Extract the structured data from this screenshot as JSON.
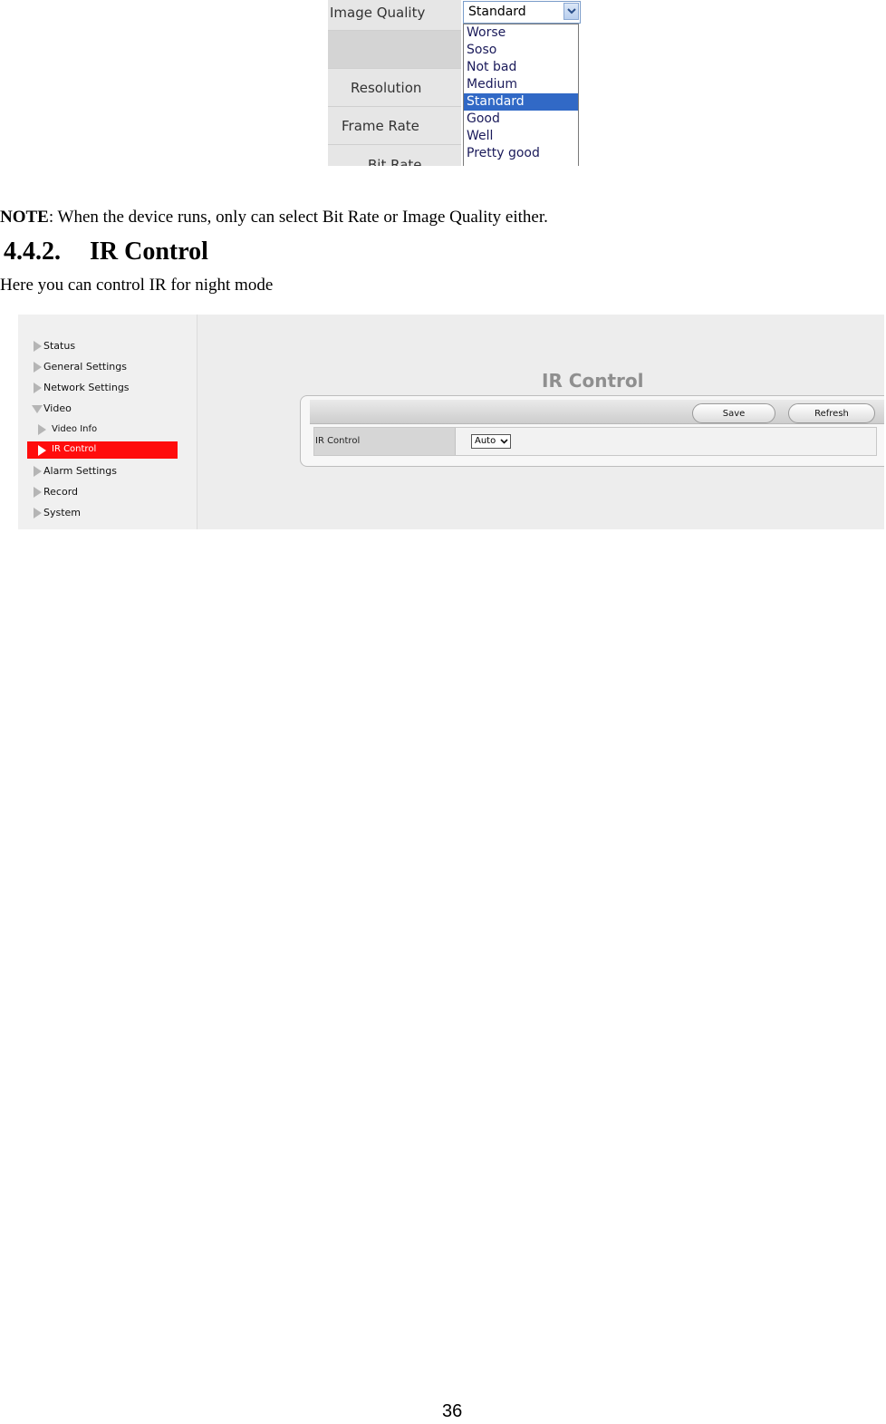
{
  "quality_screenshot": {
    "rows": [
      "Image Quality",
      "",
      "Resolution",
      "Frame Rate",
      "Bit Rate"
    ],
    "selected_value": "Standard",
    "options": [
      "Worse",
      "Soso",
      "Not bad",
      "Medium",
      "Standard",
      "Good",
      "Well",
      "Pretty good"
    ],
    "highlighted_option": "Standard"
  },
  "note": {
    "label": "NOTE",
    "text": ": When the device runs, only can select Bit Rate or Image Quality either."
  },
  "section": {
    "number": "4.4.2.",
    "title": "IR Control",
    "intro": "Here you can control IR for night mode"
  },
  "ir_screenshot": {
    "sidebar": {
      "items": [
        {
          "label": "Status"
        },
        {
          "label": "General Settings"
        },
        {
          "label": "Network Settings"
        },
        {
          "label": "Video"
        },
        {
          "label": "Video Info"
        },
        {
          "label": "IR Control"
        },
        {
          "label": "Alarm Settings"
        },
        {
          "label": "Record"
        },
        {
          "label": "System"
        }
      ],
      "active_item": "IR Control",
      "active_color": "#ff0d0d"
    },
    "title": "IR Control",
    "buttons": {
      "save": "Save",
      "refresh": "Refresh"
    },
    "field": {
      "label": "IR Control",
      "value": "Auto"
    }
  },
  "page_number": "36"
}
